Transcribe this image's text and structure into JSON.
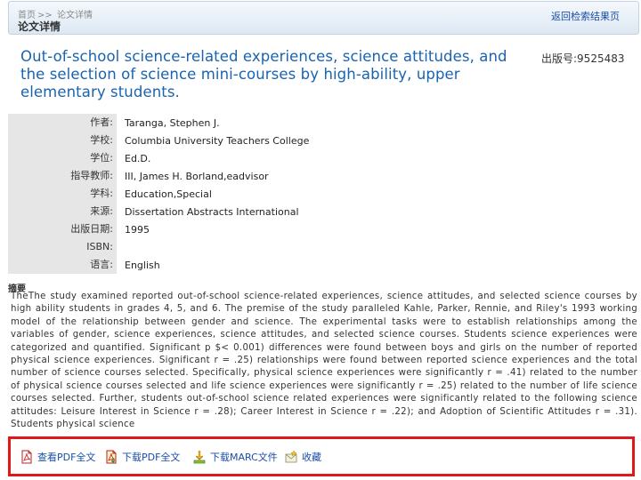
{
  "header": {
    "breadcrumb_home": "首页",
    "breadcrumb_sep": ">>",
    "breadcrumb_current": "论文详情",
    "page_title": "论文详情",
    "back_link": "返回检索结果页"
  },
  "paper": {
    "title": "Out-of-school science-related experiences, science attitudes, and the selection of science mini-courses by high-ability, upper elementary students.",
    "pub_number_label": "出版号:",
    "pub_number": "9525483"
  },
  "meta": [
    {
      "label": "作者:",
      "value": "Taranga, Stephen J."
    },
    {
      "label": "学校:",
      "value": "Columbia University Teachers College"
    },
    {
      "label": "学位:",
      "value": "Ed.D."
    },
    {
      "label": "指导教师:",
      "value": "III, James H. Borland,eadvisor"
    },
    {
      "label": "学科:",
      "value": "Education,Special"
    },
    {
      "label": "来源:",
      "value": "Dissertation Abstracts International"
    },
    {
      "label": "出版日期:",
      "value": "1995"
    },
    {
      "label": "ISBN:",
      "value": ""
    },
    {
      "label": "语言:",
      "value": "English"
    }
  ],
  "abstract": {
    "heading": "摘要",
    "text": "TheThe study examined reported out-of-school science-related experiences, science attitudes, and selected science courses by high ability students in grades 4, 5, and 6. The premise of the study paralleled Kahle, Parker, Rennie, and Riley's 1993 working model of the relationship between gender and science. The experimental tasks were to establish relationships among the variables of gender, science experiences, science attitudes, and selected science courses. Students science experiences were categorized and quantified. Significant p $< 0.001) differences were found between boys and girls on the number of reported physical science experiences. Significant r = .25) relationships were found between reported science experiences and the total number of science courses selected. Specifically, physical science experiences were significantly r = .41) related to the number of physical science courses selected and life science experiences were significantly r = .25) related to the number of life science courses selected. Further, students out-of-school science related experiences were significantly related to the following science attitudes: Leisure Interest in Science r = .28); Career Interest in Science r = .22); and Adoption of Scientific Attitudes r = .31). Students physical science"
  },
  "actions": {
    "view_pdf": "查看PDF全文",
    "download_pdf": "下载PDF全文",
    "download_marc": "下载MARC文件",
    "favorite": "收藏"
  },
  "colors": {
    "title": "#1a63b0",
    "link": "#1a4ea8",
    "highlight_border": "#e21717",
    "label_bg": "#e6e6e6"
  }
}
